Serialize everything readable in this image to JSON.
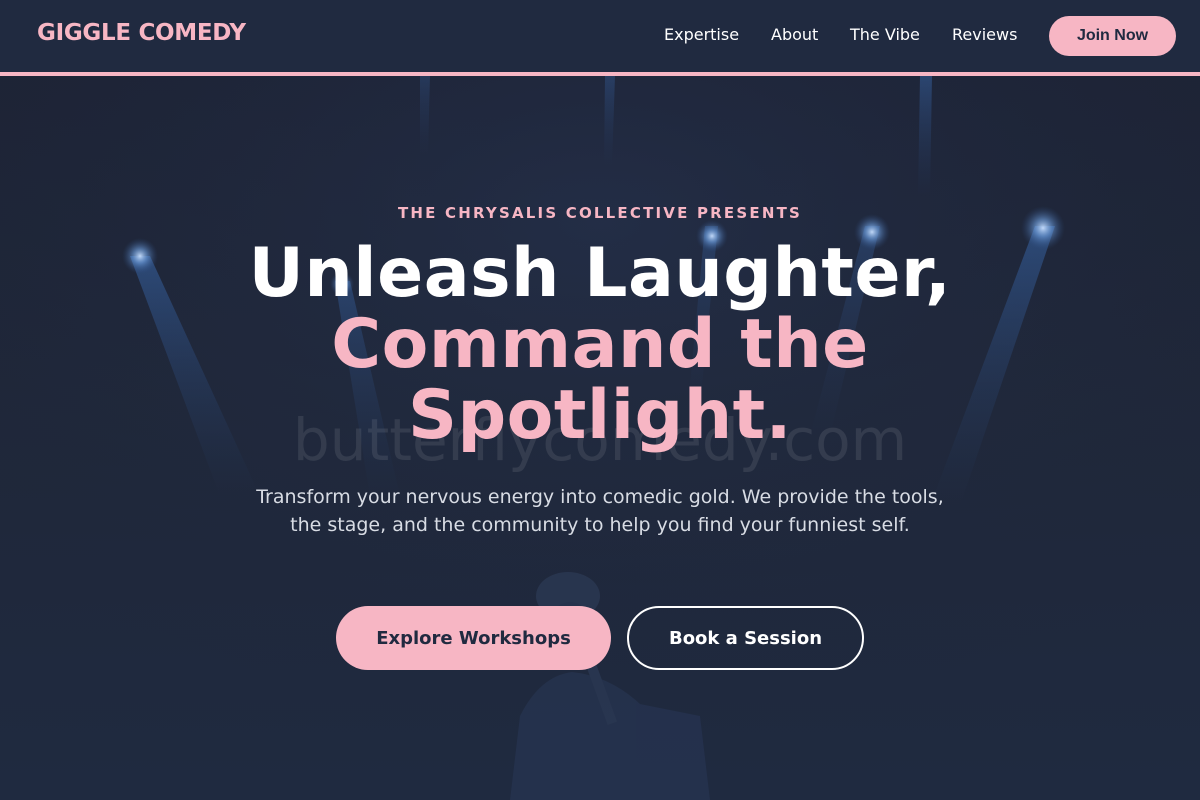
{
  "header": {
    "logo": "GIGGLE COMEDY",
    "nav": [
      "Expertise",
      "About",
      "The Vibe",
      "Reviews"
    ],
    "cta": "Join Now"
  },
  "hero": {
    "eyebrow": "THE CHRYSALIS COLLECTIVE PRESENTS",
    "headline_line1": "Unleash Laughter,",
    "headline_line2": "Command the Spotlight.",
    "watermark": "butterflycomedy.com",
    "subtitle": "Transform your nervous energy into comedic gold. We provide the tools, the stage, and the community to help you find your funniest self.",
    "primary_cta": "Explore Workshops",
    "secondary_cta": "Book a Session"
  },
  "colors": {
    "accent": "#f7b6c4",
    "header_bg": "#202a40",
    "page_bg": "#1f2a3f",
    "text_white": "#ffffff"
  },
  "icons": {
    "background": "stage-spotlights-performer-image"
  }
}
